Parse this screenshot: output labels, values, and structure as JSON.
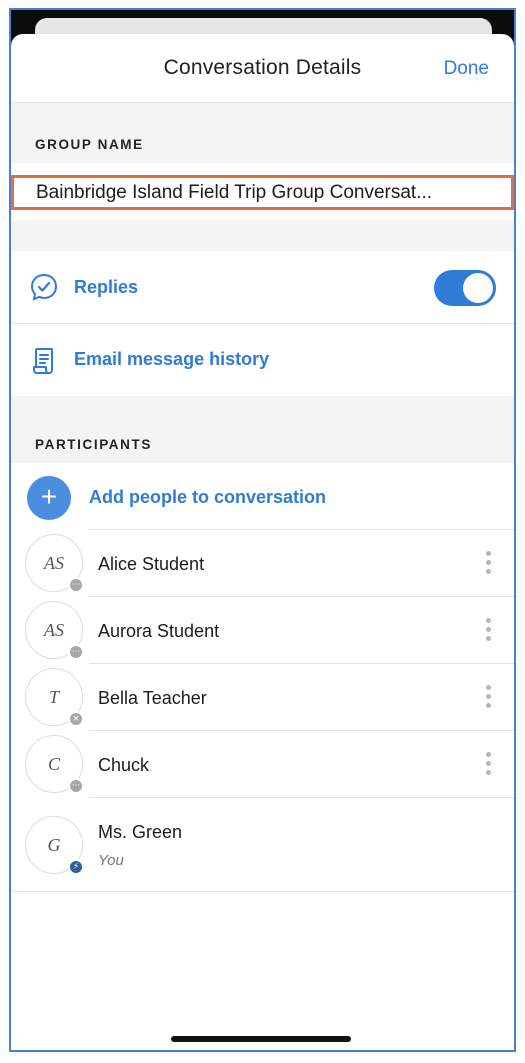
{
  "header": {
    "title": "Conversation Details",
    "done_label": "Done"
  },
  "group_name": {
    "section_label": "GROUP NAME",
    "value": "Bainbridge Island Field Trip Group Conversat..."
  },
  "options": [
    {
      "label": "Replies",
      "icon": "chat-check-icon",
      "toggle_on": true
    },
    {
      "label": "Email message history",
      "icon": "document-scroll-icon"
    }
  ],
  "participants": {
    "section_label": "PARTICIPANTS",
    "add_label": "Add people to conversation",
    "add_symbol": "+",
    "people": [
      {
        "initials": "AS",
        "name": "Alice Student",
        "badge": "···",
        "badge_icon": "more-icon"
      },
      {
        "initials": "AS",
        "name": "Aurora Student",
        "badge": "···",
        "badge_icon": "more-icon"
      },
      {
        "initials": "T",
        "name": "Bella Teacher",
        "badge": "×",
        "badge_icon": "close-icon"
      },
      {
        "initials": "C",
        "name": "Chuck",
        "badge": "···",
        "badge_icon": "more-icon"
      },
      {
        "initials": "G",
        "name": "Ms. Green",
        "subtitle": "You",
        "badge": "⚡",
        "badge_icon": "lightning-icon"
      }
    ]
  },
  "colors": {
    "accent": "#2f7bd8",
    "highlight_border": "#e07040",
    "section_bg": "#f4f4f4"
  }
}
